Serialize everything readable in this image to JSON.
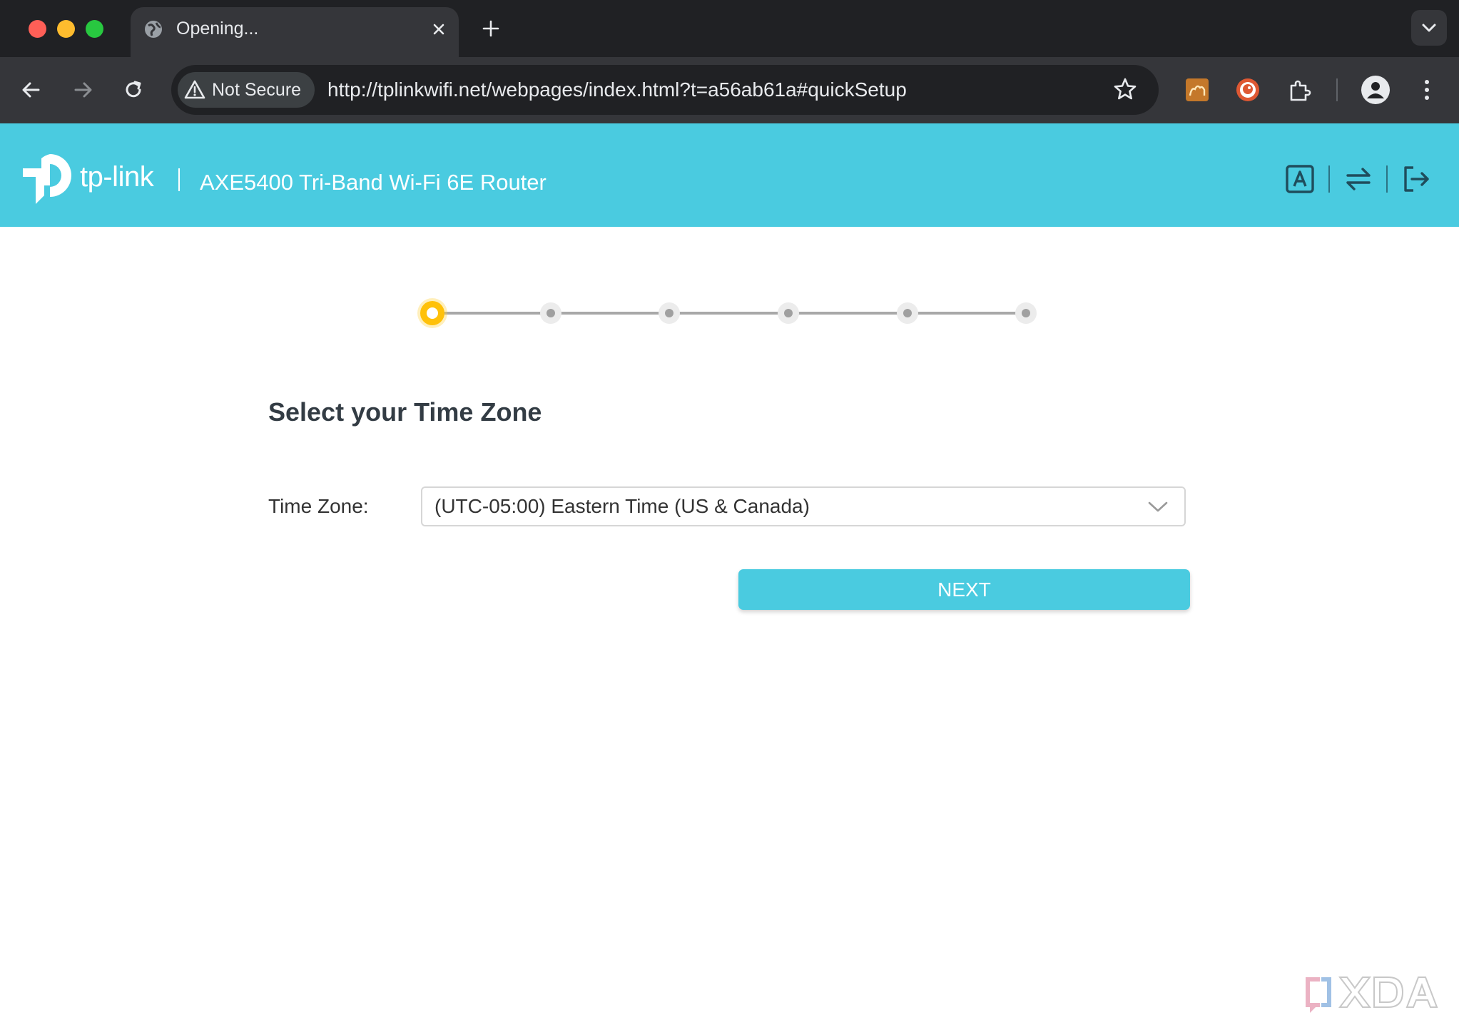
{
  "browser": {
    "tab_title": "Opening...",
    "security_label": "Not Secure",
    "url": "http://tplinkwifi.net/webpages/index.html?t=a56ab61a#quickSetup"
  },
  "header": {
    "logo_text": "tp-link",
    "product_name": "AXE5400 Tri-Band Wi-Fi 6E Router",
    "icons": [
      "language-icon",
      "switch-mode-icon",
      "logout-icon"
    ],
    "accent_color": "#4acbe0"
  },
  "stepper": {
    "total_steps": 6,
    "current_step": 1,
    "active_color": "#ffc10a"
  },
  "form": {
    "title": "Select your Time Zone",
    "timezone_label": "Time Zone:",
    "timezone_value": "(UTC-05:00) Eastern Time (US & Canada)",
    "next_label": "NEXT"
  },
  "watermark": {
    "text": "XDA"
  }
}
